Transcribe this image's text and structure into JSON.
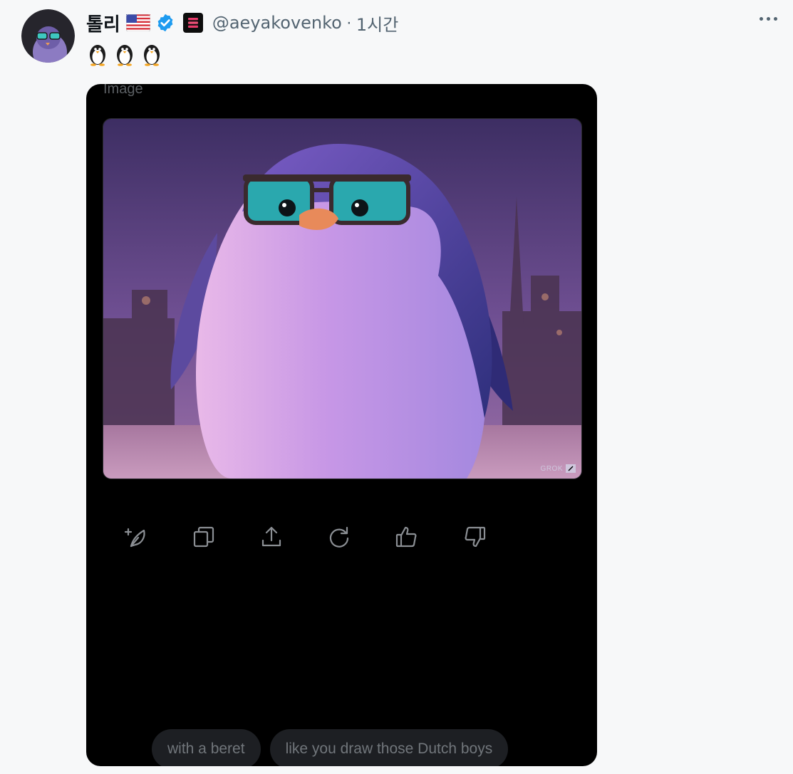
{
  "author": {
    "display_name": "톨리",
    "handle": "@aeyakovenko",
    "separator": "·",
    "time": "1시간"
  },
  "tweet": {
    "text_icons": [
      "penguin-emoji",
      "penguin-emoji",
      "penguin-emoji"
    ]
  },
  "card": {
    "label": "Image",
    "watermark": "GROK",
    "actions": [
      "regenerate-feather-icon",
      "copy-icon",
      "share-icon",
      "refresh-icon",
      "thumbs-up-icon",
      "thumbs-down-icon"
    ],
    "suggestions": [
      "with a beret",
      "like you draw those Dutch boys"
    ]
  },
  "colors": {
    "background": "#f7f8f9",
    "card_background": "#000000",
    "verified_blue": "#1d9bf0",
    "muted_text": "#536471",
    "chip_background": "#1d1f23"
  }
}
